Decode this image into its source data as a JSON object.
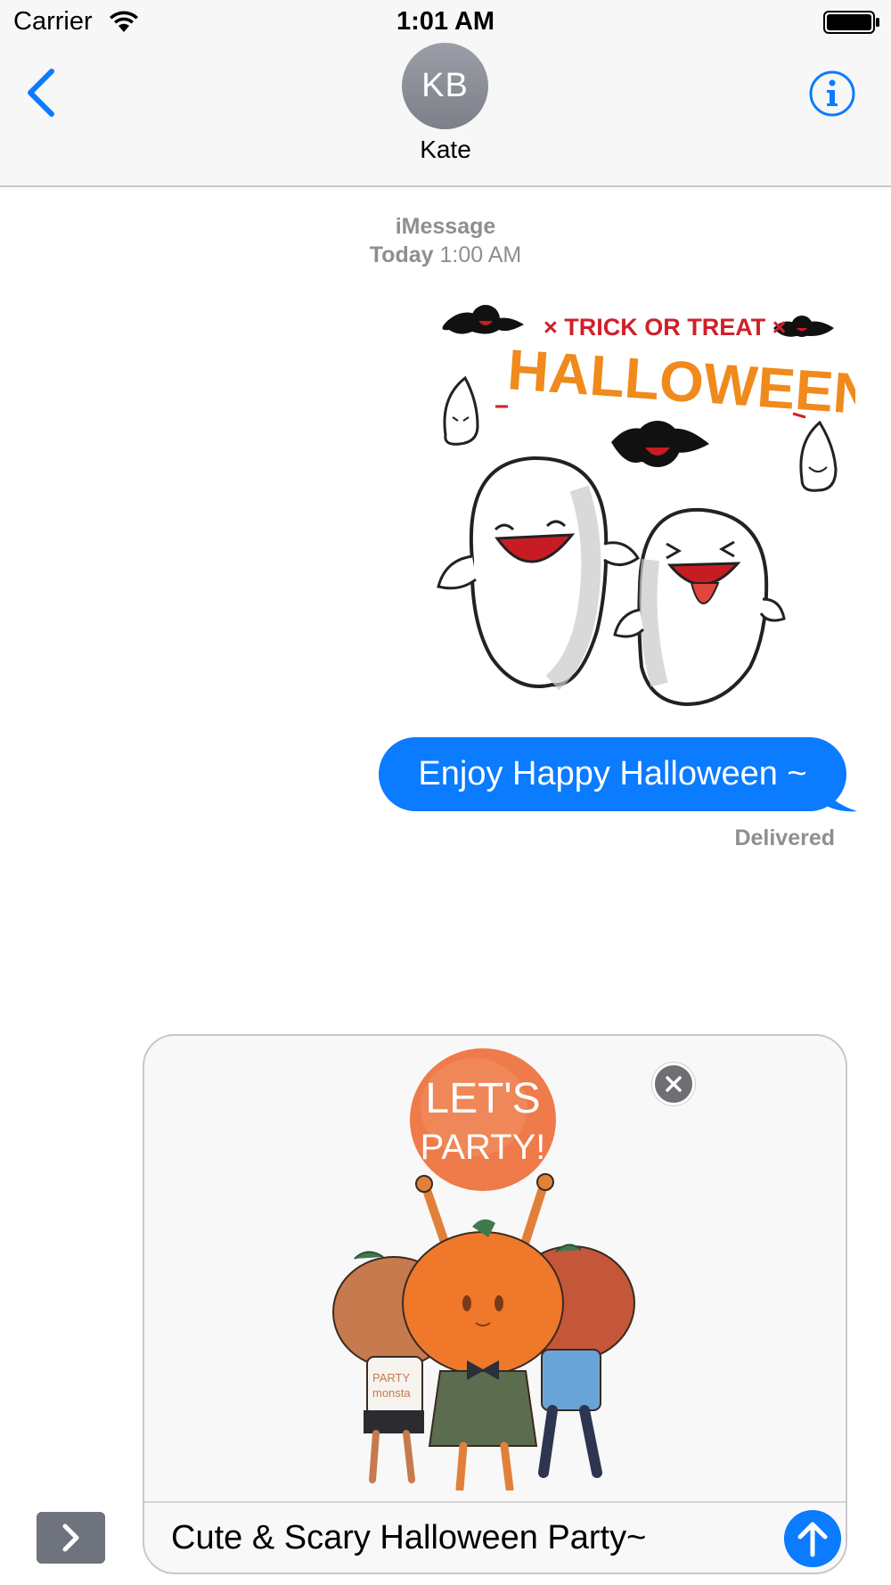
{
  "status_bar": {
    "carrier": "Carrier",
    "time": "1:01 AM",
    "wifi_icon": "wifi-icon",
    "battery_icon": "battery-icon"
  },
  "nav": {
    "back_icon": "chevron-left-icon",
    "avatar_initials": "KB",
    "contact_name": "Kate",
    "info_icon": "info-icon"
  },
  "thread": {
    "service": "iMessage",
    "day": "Today",
    "time": "1:00 AM",
    "messages": [
      {
        "type": "sticker",
        "description_icon": "halloween-ghosts-sticker",
        "lettering": [
          "TRICK OR TREAT",
          "HALLOWEEN"
        ]
      },
      {
        "type": "text",
        "text": "Enjoy Happy Halloween ~",
        "status": "Delivered"
      }
    ]
  },
  "compose": {
    "expand_icon": "chevron-right-icon",
    "attachment_icon": "pumpkin-party-sticker",
    "attachment_lettering": [
      "LET'S",
      "PARTY!",
      "PARTY monsta"
    ],
    "remove_icon": "close-icon",
    "text": "Cute & Scary Halloween Party~",
    "send_icon": "arrow-up-icon"
  },
  "colors": {
    "accent": "#0b7bff",
    "nav_background": "#f7f7f7",
    "secondary_text": "#8e8e93",
    "orange": "#f08a1c",
    "red": "#d0202a"
  }
}
